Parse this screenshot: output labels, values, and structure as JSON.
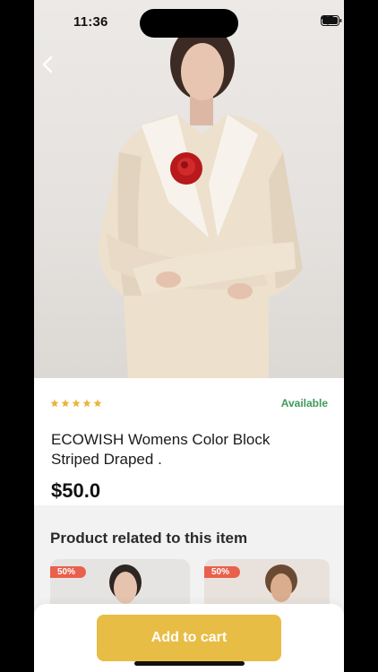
{
  "status_bar": {
    "time": "11:36"
  },
  "product": {
    "rating_stars": 5,
    "availability": "Available",
    "title": "ECOWISH Womens Color Block Striped Draped .",
    "price": "$50.0"
  },
  "related": {
    "heading": "Product related to this item",
    "items": [
      {
        "badge": "50%"
      },
      {
        "badge": "50%"
      }
    ]
  },
  "actions": {
    "add_to_cart": "Add to cart"
  },
  "colors": {
    "accent": "#e8bd45",
    "available": "#3e9a5a",
    "badge": "#e9604d",
    "star": "#e8b53a"
  },
  "icons": [
    "back-chevron-icon",
    "wifi-icon",
    "battery-icon",
    "signal-icon",
    "star-icon"
  ]
}
